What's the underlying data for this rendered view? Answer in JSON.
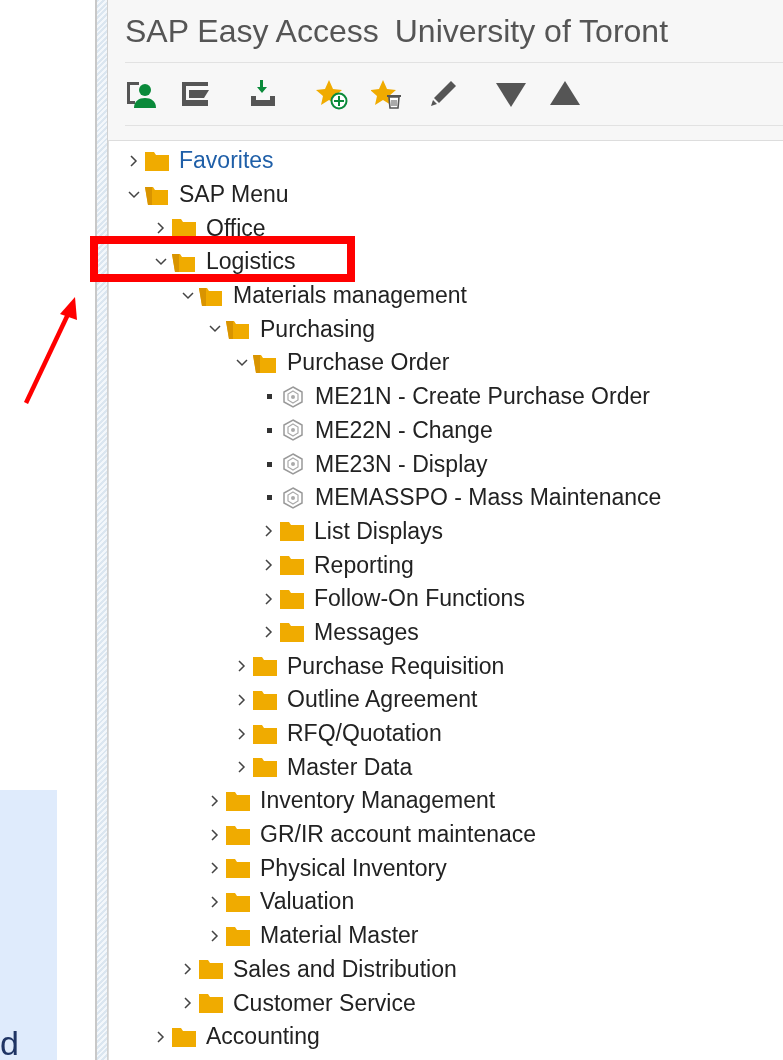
{
  "screen": {
    "title": "SAP Easy Access",
    "subtitle": "University of Toront",
    "tree": [
      {
        "kind": "favorites",
        "label": "Favorites",
        "expanded": false
      },
      {
        "kind": "folder",
        "label": "SAP Menu",
        "expanded": true,
        "children": [
          {
            "kind": "folder",
            "label": "Office",
            "expanded": false
          },
          {
            "kind": "folder",
            "label": "Logistics",
            "expanded": true,
            "children": [
              {
                "kind": "folder",
                "label": "Materials management",
                "expanded": true,
                "children": [
                  {
                    "kind": "folder",
                    "label": "Purchasing",
                    "expanded": true,
                    "children": [
                      {
                        "kind": "folder",
                        "label": "Purchase Order",
                        "expanded": true,
                        "children": [
                          {
                            "kind": "transaction",
                            "label": "ME21N - Create Purchase Order"
                          },
                          {
                            "kind": "transaction",
                            "label": "ME22N - Change"
                          },
                          {
                            "kind": "transaction",
                            "label": "ME23N - Display"
                          },
                          {
                            "kind": "transaction",
                            "label": "MEMASSPO - Mass Maintenance"
                          },
                          {
                            "kind": "folder",
                            "label": "List Displays",
                            "expanded": false
                          },
                          {
                            "kind": "folder",
                            "label": "Reporting",
                            "expanded": false
                          },
                          {
                            "kind": "folder",
                            "label": "Follow-On Functions",
                            "expanded": false
                          },
                          {
                            "kind": "folder",
                            "label": "Messages",
                            "expanded": false
                          }
                        ]
                      },
                      {
                        "kind": "folder",
                        "label": "Purchase Requisition",
                        "expanded": false
                      },
                      {
                        "kind": "folder",
                        "label": "Outline Agreement",
                        "expanded": false
                      },
                      {
                        "kind": "folder",
                        "label": "RFQ/Quotation",
                        "expanded": false
                      },
                      {
                        "kind": "folder",
                        "label": "Master Data",
                        "expanded": false
                      }
                    ]
                  },
                  {
                    "kind": "folder",
                    "label": "Inventory Management",
                    "expanded": false
                  },
                  {
                    "kind": "folder",
                    "label": "GR/IR account maintenace",
                    "expanded": false
                  },
                  {
                    "kind": "folder",
                    "label": "Physical Inventory",
                    "expanded": false
                  },
                  {
                    "kind": "folder",
                    "label": "Valuation",
                    "expanded": false
                  },
                  {
                    "kind": "folder",
                    "label": "Material Master",
                    "expanded": false
                  }
                ]
              },
              {
                "kind": "folder",
                "label": "Sales and Distribution",
                "expanded": false
              },
              {
                "kind": "folder",
                "label": "Customer Service",
                "expanded": false
              }
            ]
          },
          {
            "kind": "folder",
            "label": "Accounting",
            "expanded": false
          }
        ]
      }
    ]
  },
  "note": {
    "text": "d"
  }
}
